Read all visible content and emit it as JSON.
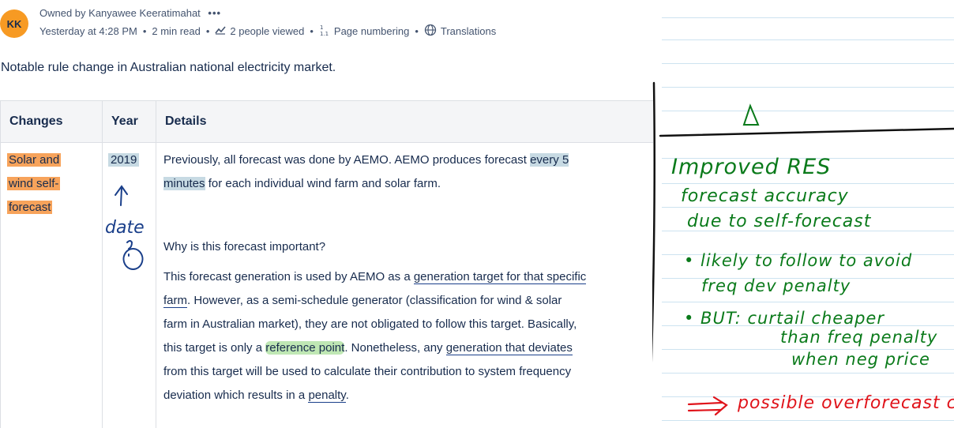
{
  "header": {
    "avatar_initials": "KK",
    "owner": "Owned by Kanyawee Keeratimahat",
    "more": "•••",
    "timestamp": "Yesterday at 4:28 PM",
    "read_time": "2 min read",
    "viewers": "2 people viewed",
    "page_numbering": "Page numbering",
    "translations": "Translations",
    "bullet": "•"
  },
  "intro": "Notable rule change in Australian national electricity market.",
  "table": {
    "headers": [
      "Changes",
      "Year",
      "Details"
    ],
    "row": {
      "change_lines": [
        "Solar and",
        "wind self-",
        "forecast"
      ],
      "year": "2019",
      "details": {
        "p1_a": "Previously, all forecast was done by AEMO. AEMO produces forecast ",
        "p1_hl1": "every 5",
        "p1_hl2": "minutes",
        "p1_b": " for each individual wind farm and solar farm.",
        "question": "Why is this forecast important?",
        "l1_a": "This forecast generation is used by AEMO as a ",
        "l1_u": "generation target for that specific",
        "l2_u": "farm",
        "l2_b": ". However, as a semi-schedule generator (classification for wind & solar",
        "l3": "farm in Australian market), they are not obligated to follow this target. Basically,",
        "l4_a": "this target is only a ",
        "l4_hl": "reference point",
        "l4_b": ". Nonetheless, any ",
        "l4_u": "generation that deviates",
        "l5": "from this target will be used to calculate their contribution to system frequency",
        "l6_a": "deviation which results in a ",
        "l6_u": "penalty",
        "l6_b": "."
      }
    }
  },
  "annotations": {
    "year_note": "date",
    "notes_lines": [
      "Improved RES",
      "forecast accuracy",
      "due to self-forecast",
      "• likely to follow to avoid",
      "freq dev penalty",
      "• BUT: curtail cheaper",
      "than freq penalty",
      "when neg price"
    ],
    "arrow_text": "possible overforecast c",
    "colors": {
      "green_ink": "#0a7a1a",
      "red_ink": "#e0141b",
      "blue_ink": "#1a3f8a"
    }
  }
}
